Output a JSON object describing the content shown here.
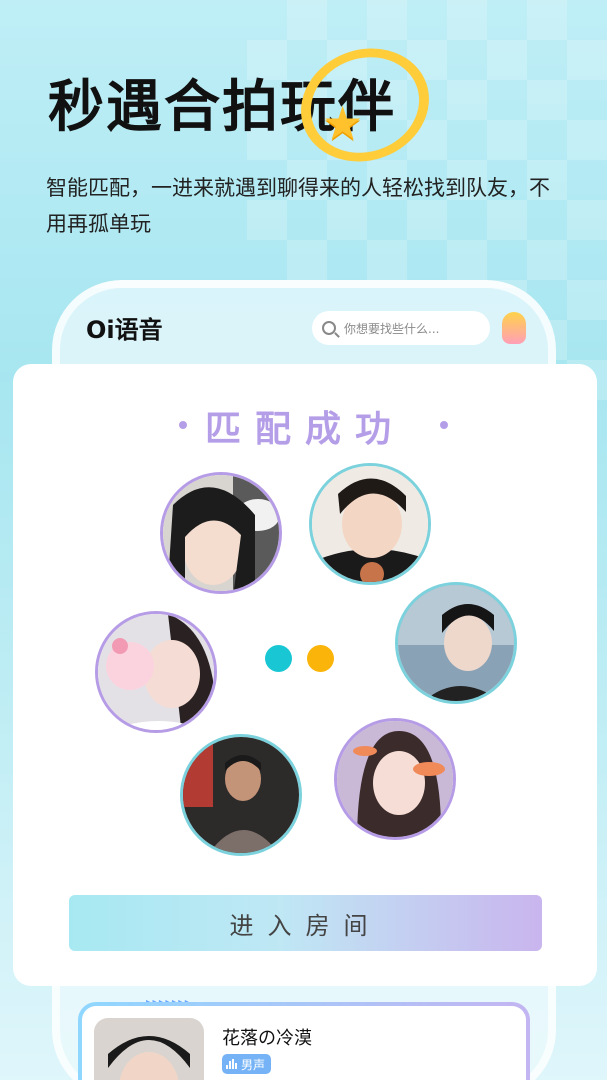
{
  "hero": {
    "headline": "秒遇合拍玩伴",
    "subtitle": "智能匹配，一进来就遇到聊得来的人轻松找到队友，不用再孤单玩"
  },
  "app": {
    "logo": "Oi语音",
    "search_placeholder": "你想要找些什么..."
  },
  "match_card": {
    "title": "匹配成功",
    "enter_button": "进入房间",
    "dot_colors": [
      "#19c7d4",
      "#fbb40a"
    ],
    "avatars": [
      {
        "name": "avatar-girl-cat",
        "border": "purple"
      },
      {
        "name": "avatar-boy-cake",
        "border": "teal"
      },
      {
        "name": "avatar-boy-snow",
        "border": "teal"
      },
      {
        "name": "avatar-girl-kitty",
        "border": "purple"
      },
      {
        "name": "avatar-man-street",
        "border": "teal"
      },
      {
        "name": "avatar-girl-fish",
        "border": "purple"
      }
    ]
  },
  "preview": {
    "username": "花落の冷漠",
    "voice_tag": "男声"
  },
  "colors": {
    "accent_purple": "#b59ee8",
    "accent_teal": "#7bd2dd",
    "tag_blue": "#75b3f6"
  }
}
